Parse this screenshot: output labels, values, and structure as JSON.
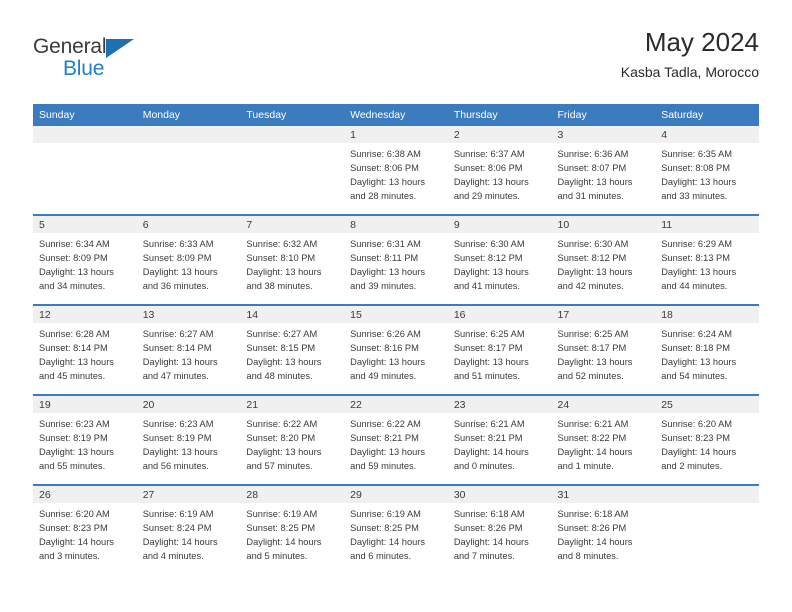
{
  "brand": {
    "name_top": "General",
    "name_bottom": "Blue",
    "accent_color": "#1f7fd0",
    "triangle_color": "#1f6fb5"
  },
  "header": {
    "title": "May 2024",
    "subtitle": "Kasba Tadla, Morocco"
  },
  "theme": {
    "header_row_bg": "#3a7cbe",
    "header_row_text": "#ffffff",
    "daynum_band_bg": "#f0f0f0",
    "cell_text": "#3b3b3b",
    "row_divider": "#3a7cbe"
  },
  "weekday_headers": [
    "Sunday",
    "Monday",
    "Tuesday",
    "Wednesday",
    "Thursday",
    "Friday",
    "Saturday"
  ],
  "weeks": [
    [
      {
        "day": "",
        "lines": []
      },
      {
        "day": "",
        "lines": []
      },
      {
        "day": "",
        "lines": []
      },
      {
        "day": "1",
        "lines": [
          "Sunrise: 6:38 AM",
          "Sunset: 8:06 PM",
          "Daylight: 13 hours",
          "and 28 minutes."
        ]
      },
      {
        "day": "2",
        "lines": [
          "Sunrise: 6:37 AM",
          "Sunset: 8:06 PM",
          "Daylight: 13 hours",
          "and 29 minutes."
        ]
      },
      {
        "day": "3",
        "lines": [
          "Sunrise: 6:36 AM",
          "Sunset: 8:07 PM",
          "Daylight: 13 hours",
          "and 31 minutes."
        ]
      },
      {
        "day": "4",
        "lines": [
          "Sunrise: 6:35 AM",
          "Sunset: 8:08 PM",
          "Daylight: 13 hours",
          "and 33 minutes."
        ]
      }
    ],
    [
      {
        "day": "5",
        "lines": [
          "Sunrise: 6:34 AM",
          "Sunset: 8:09 PM",
          "Daylight: 13 hours",
          "and 34 minutes."
        ]
      },
      {
        "day": "6",
        "lines": [
          "Sunrise: 6:33 AM",
          "Sunset: 8:09 PM",
          "Daylight: 13 hours",
          "and 36 minutes."
        ]
      },
      {
        "day": "7",
        "lines": [
          "Sunrise: 6:32 AM",
          "Sunset: 8:10 PM",
          "Daylight: 13 hours",
          "and 38 minutes."
        ]
      },
      {
        "day": "8",
        "lines": [
          "Sunrise: 6:31 AM",
          "Sunset: 8:11 PM",
          "Daylight: 13 hours",
          "and 39 minutes."
        ]
      },
      {
        "day": "9",
        "lines": [
          "Sunrise: 6:30 AM",
          "Sunset: 8:12 PM",
          "Daylight: 13 hours",
          "and 41 minutes."
        ]
      },
      {
        "day": "10",
        "lines": [
          "Sunrise: 6:30 AM",
          "Sunset: 8:12 PM",
          "Daylight: 13 hours",
          "and 42 minutes."
        ]
      },
      {
        "day": "11",
        "lines": [
          "Sunrise: 6:29 AM",
          "Sunset: 8:13 PM",
          "Daylight: 13 hours",
          "and 44 minutes."
        ]
      }
    ],
    [
      {
        "day": "12",
        "lines": [
          "Sunrise: 6:28 AM",
          "Sunset: 8:14 PM",
          "Daylight: 13 hours",
          "and 45 minutes."
        ]
      },
      {
        "day": "13",
        "lines": [
          "Sunrise: 6:27 AM",
          "Sunset: 8:14 PM",
          "Daylight: 13 hours",
          "and 47 minutes."
        ]
      },
      {
        "day": "14",
        "lines": [
          "Sunrise: 6:27 AM",
          "Sunset: 8:15 PM",
          "Daylight: 13 hours",
          "and 48 minutes."
        ]
      },
      {
        "day": "15",
        "lines": [
          "Sunrise: 6:26 AM",
          "Sunset: 8:16 PM",
          "Daylight: 13 hours",
          "and 49 minutes."
        ]
      },
      {
        "day": "16",
        "lines": [
          "Sunrise: 6:25 AM",
          "Sunset: 8:17 PM",
          "Daylight: 13 hours",
          "and 51 minutes."
        ]
      },
      {
        "day": "17",
        "lines": [
          "Sunrise: 6:25 AM",
          "Sunset: 8:17 PM",
          "Daylight: 13 hours",
          "and 52 minutes."
        ]
      },
      {
        "day": "18",
        "lines": [
          "Sunrise: 6:24 AM",
          "Sunset: 8:18 PM",
          "Daylight: 13 hours",
          "and 54 minutes."
        ]
      }
    ],
    [
      {
        "day": "19",
        "lines": [
          "Sunrise: 6:23 AM",
          "Sunset: 8:19 PM",
          "Daylight: 13 hours",
          "and 55 minutes."
        ]
      },
      {
        "day": "20",
        "lines": [
          "Sunrise: 6:23 AM",
          "Sunset: 8:19 PM",
          "Daylight: 13 hours",
          "and 56 minutes."
        ]
      },
      {
        "day": "21",
        "lines": [
          "Sunrise: 6:22 AM",
          "Sunset: 8:20 PM",
          "Daylight: 13 hours",
          "and 57 minutes."
        ]
      },
      {
        "day": "22",
        "lines": [
          "Sunrise: 6:22 AM",
          "Sunset: 8:21 PM",
          "Daylight: 13 hours",
          "and 59 minutes."
        ]
      },
      {
        "day": "23",
        "lines": [
          "Sunrise: 6:21 AM",
          "Sunset: 8:21 PM",
          "Daylight: 14 hours",
          "and 0 minutes."
        ]
      },
      {
        "day": "24",
        "lines": [
          "Sunrise: 6:21 AM",
          "Sunset: 8:22 PM",
          "Daylight: 14 hours",
          "and 1 minute."
        ]
      },
      {
        "day": "25",
        "lines": [
          "Sunrise: 6:20 AM",
          "Sunset: 8:23 PM",
          "Daylight: 14 hours",
          "and 2 minutes."
        ]
      }
    ],
    [
      {
        "day": "26",
        "lines": [
          "Sunrise: 6:20 AM",
          "Sunset: 8:23 PM",
          "Daylight: 14 hours",
          "and 3 minutes."
        ]
      },
      {
        "day": "27",
        "lines": [
          "Sunrise: 6:19 AM",
          "Sunset: 8:24 PM",
          "Daylight: 14 hours",
          "and 4 minutes."
        ]
      },
      {
        "day": "28",
        "lines": [
          "Sunrise: 6:19 AM",
          "Sunset: 8:25 PM",
          "Daylight: 14 hours",
          "and 5 minutes."
        ]
      },
      {
        "day": "29",
        "lines": [
          "Sunrise: 6:19 AM",
          "Sunset: 8:25 PM",
          "Daylight: 14 hours",
          "and 6 minutes."
        ]
      },
      {
        "day": "30",
        "lines": [
          "Sunrise: 6:18 AM",
          "Sunset: 8:26 PM",
          "Daylight: 14 hours",
          "and 7 minutes."
        ]
      },
      {
        "day": "31",
        "lines": [
          "Sunrise: 6:18 AM",
          "Sunset: 8:26 PM",
          "Daylight: 14 hours",
          "and 8 minutes."
        ]
      },
      {
        "day": "",
        "lines": []
      }
    ]
  ]
}
